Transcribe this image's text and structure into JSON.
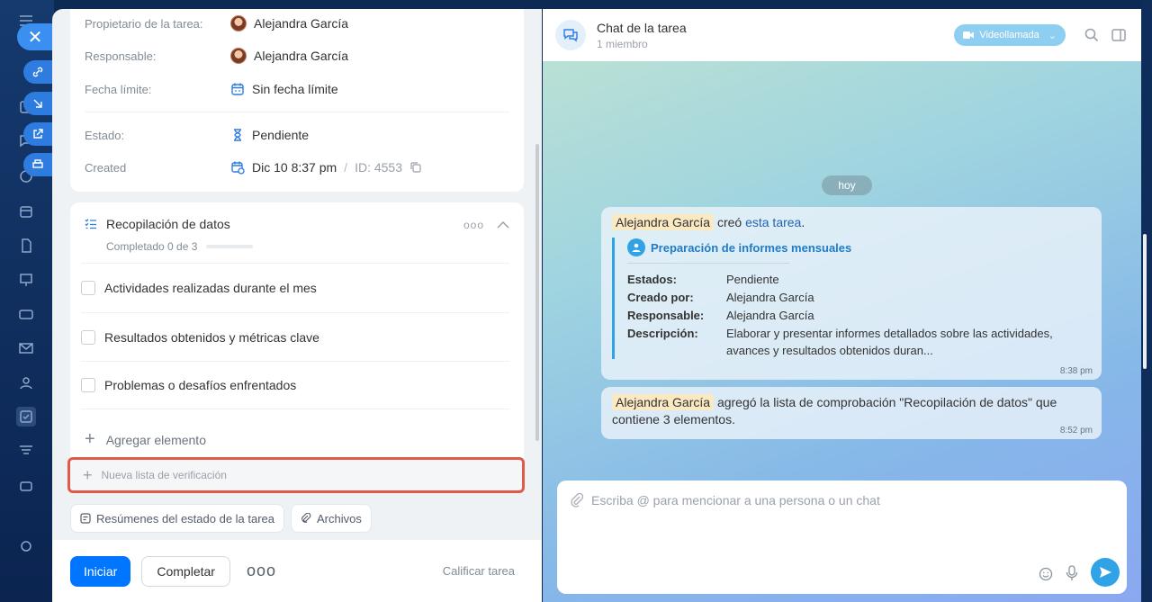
{
  "task": {
    "fields": [
      {
        "label": "Propietario de la tarea:",
        "value": "Alejandra García",
        "kind": "user"
      },
      {
        "label": "Responsable:",
        "value": "Alejandra García",
        "kind": "user"
      },
      {
        "label": "Fecha límite:",
        "value": "Sin fecha límite",
        "kind": "date"
      },
      {
        "label": "Estado:",
        "value": "Pendiente",
        "kind": "status"
      },
      {
        "label": "Created",
        "value": "Dic 10 8:37 pm",
        "kind": "created",
        "id_text": "ID: 4553"
      }
    ],
    "checklist": {
      "title": "Recopilación de datos",
      "subtitle": "Completado 0 de 3",
      "progress": 0,
      "items": [
        "Actividades realizadas durante el mes",
        "Resultados obtenidos y métricas clave",
        "Problemas o desafíos enfrentados"
      ],
      "add_label": "Agregar elemento"
    },
    "new_list_placeholder": "Nueva lista de verificación",
    "chips": {
      "summaries": "Resúmenes del estado de la tarea",
      "files": "Archivos"
    },
    "footer": {
      "start": "Iniciar",
      "complete": "Completar",
      "more": "ooo",
      "rate": "Calificar tarea"
    },
    "separator": "/"
  },
  "chat": {
    "title": "Chat de la tarea",
    "subtitle": "1 miembro",
    "video_label": "Videollamada",
    "day": "hoy",
    "msg1": {
      "author": "Alejandra García",
      "verb": "creó",
      "link": "esta tarea",
      "end": ".",
      "task_title": "Preparación de informes mensuales",
      "rows": [
        {
          "k": "Estados:",
          "v": "Pendiente"
        },
        {
          "k": "Creado por:",
          "v": "Alejandra García"
        },
        {
          "k": "Responsable:",
          "v": "Alejandra García"
        },
        {
          "k": "Descripción:",
          "v": "Elaborar y presentar informes detallados sobre las actividades, avances y resultados obtenidos duran..."
        }
      ],
      "time": "8:38 pm"
    },
    "msg2": {
      "author": "Alejandra García",
      "text": " agregó la lista de comprobación \"Recopilación de datos\" que contiene 3 elementos.",
      "time": "8:52 pm"
    },
    "input_placeholder": "Escriba @ para mencionar a una persona o un chat"
  },
  "colors": {
    "primary": "#0075ff",
    "highlight_border": "#e05a4a",
    "chat_accent": "#2fa3e6"
  }
}
